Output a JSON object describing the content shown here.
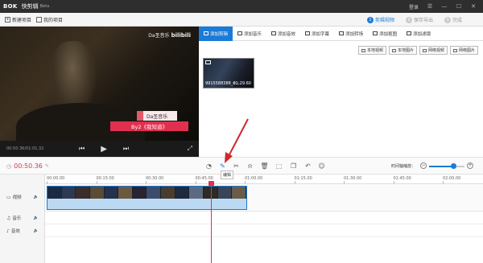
{
  "title_bar": {
    "logo": "BOK",
    "app_name": "快剪辑",
    "beta": "Beta",
    "login": "登录"
  },
  "toolbar": {
    "new_project": "新建项目",
    "my_projects": "我的项目"
  },
  "steps": [
    {
      "num": "1",
      "label": "剪辑视频"
    },
    {
      "num": "2",
      "label": "保存导出"
    },
    {
      "num": "3",
      "label": "完成"
    }
  ],
  "preview": {
    "watermark": "Da圣音乐",
    "watermark_logo": "bilibili",
    "subtitle_small": "Da圣音乐",
    "subtitle_large": "By2《我知道》",
    "time": "00:50.36/01:01.32"
  },
  "tabs": [
    {
      "label": "添加剪辑",
      "icon": "video-icon"
    },
    {
      "label": "添加音乐",
      "icon": "music-icon"
    },
    {
      "label": "添加音效",
      "icon": "sound-icon"
    },
    {
      "label": "添加字幕",
      "icon": "text-icon"
    },
    {
      "label": "添加转场",
      "icon": "transition-icon"
    },
    {
      "label": "添加抠图",
      "icon": "cutout-icon"
    },
    {
      "label": "添加滤镜",
      "icon": "filter-icon"
    }
  ],
  "media_buttons": [
    {
      "label": "本地视频"
    },
    {
      "label": "本地图片"
    },
    {
      "label": "网络视频"
    },
    {
      "label": "网络图片"
    }
  ],
  "media_item": {
    "name": "9915588388_n...",
    "duration": "01:29.60"
  },
  "edit_toolbar": {
    "current_time": "00:50.36",
    "tooltip": "编辑",
    "zoom_label": "时间轴缩放：",
    "zoom_level": 0.7
  },
  "ruler_ticks": [
    "00:00.00",
    "00:15.00",
    "00:30.00",
    "00:45.00",
    "01:00.00",
    "01:15.00",
    "01:30.00",
    "01:45.00",
    "02:00.00"
  ],
  "lanes": {
    "video": "视频",
    "music": "音乐",
    "effects": "音效"
  },
  "colors": {
    "accent": "#1a7bd8",
    "playhead": "#e0304f",
    "arrow": "#d0282c"
  }
}
